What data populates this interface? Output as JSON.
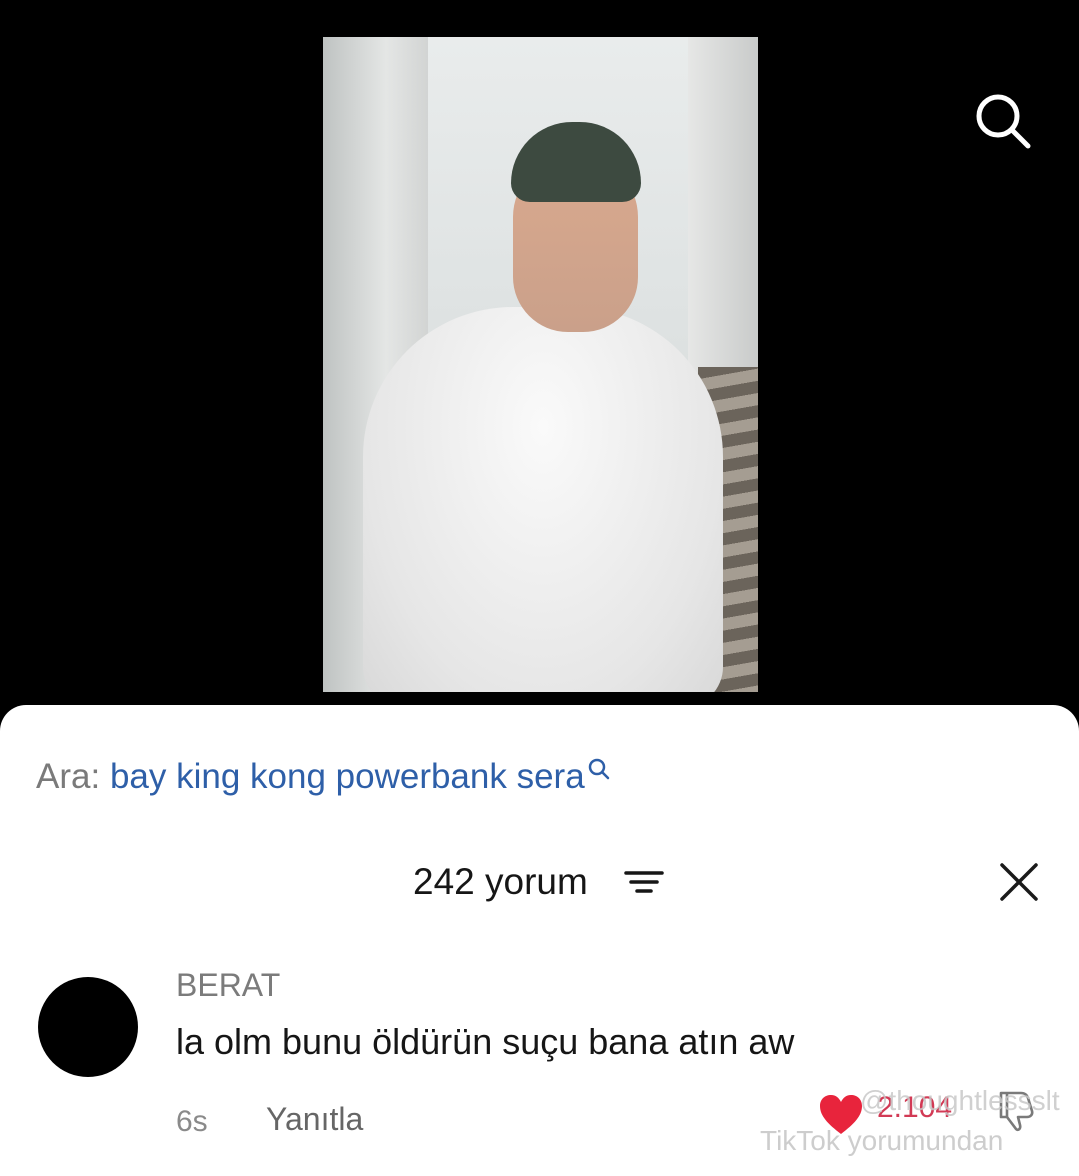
{
  "search": {
    "prefix": "Ara:",
    "query": "bay king kong powerbank sera"
  },
  "comments_header": {
    "count_label": "242 yorum"
  },
  "comment": {
    "username": "BERAT",
    "text": "la olm bunu öldürün suçu bana atın aw",
    "time": "6s",
    "reply_label": "Yanıtla",
    "likes": "2.104"
  },
  "watermark": {
    "handle": "@thoughtlessslt",
    "brand": "TikTok yorumundan"
  },
  "colors": {
    "query_link": "#2e5fa8",
    "like_heart": "#e8243c",
    "like_count": "#d23a55"
  }
}
